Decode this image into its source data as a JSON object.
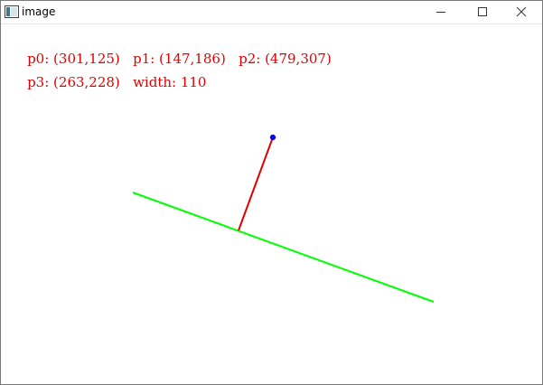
{
  "window": {
    "title": "image",
    "icon": "app-window-icon",
    "controls": [
      "minimize-icon",
      "maximize-icon",
      "close-icon"
    ]
  },
  "overlay": {
    "p0_label": "p0: (301,125)",
    "p1_label": "p1: (147,186)",
    "p2_label": "p2: (479,307)",
    "p3_label": "p3: (263,228)",
    "width_label": "width: 110",
    "text_color": "#e00000"
  },
  "colors": {
    "green_line": "#00ff00",
    "red_segment": "#e00000",
    "point_marker": "#0000ff"
  }
}
